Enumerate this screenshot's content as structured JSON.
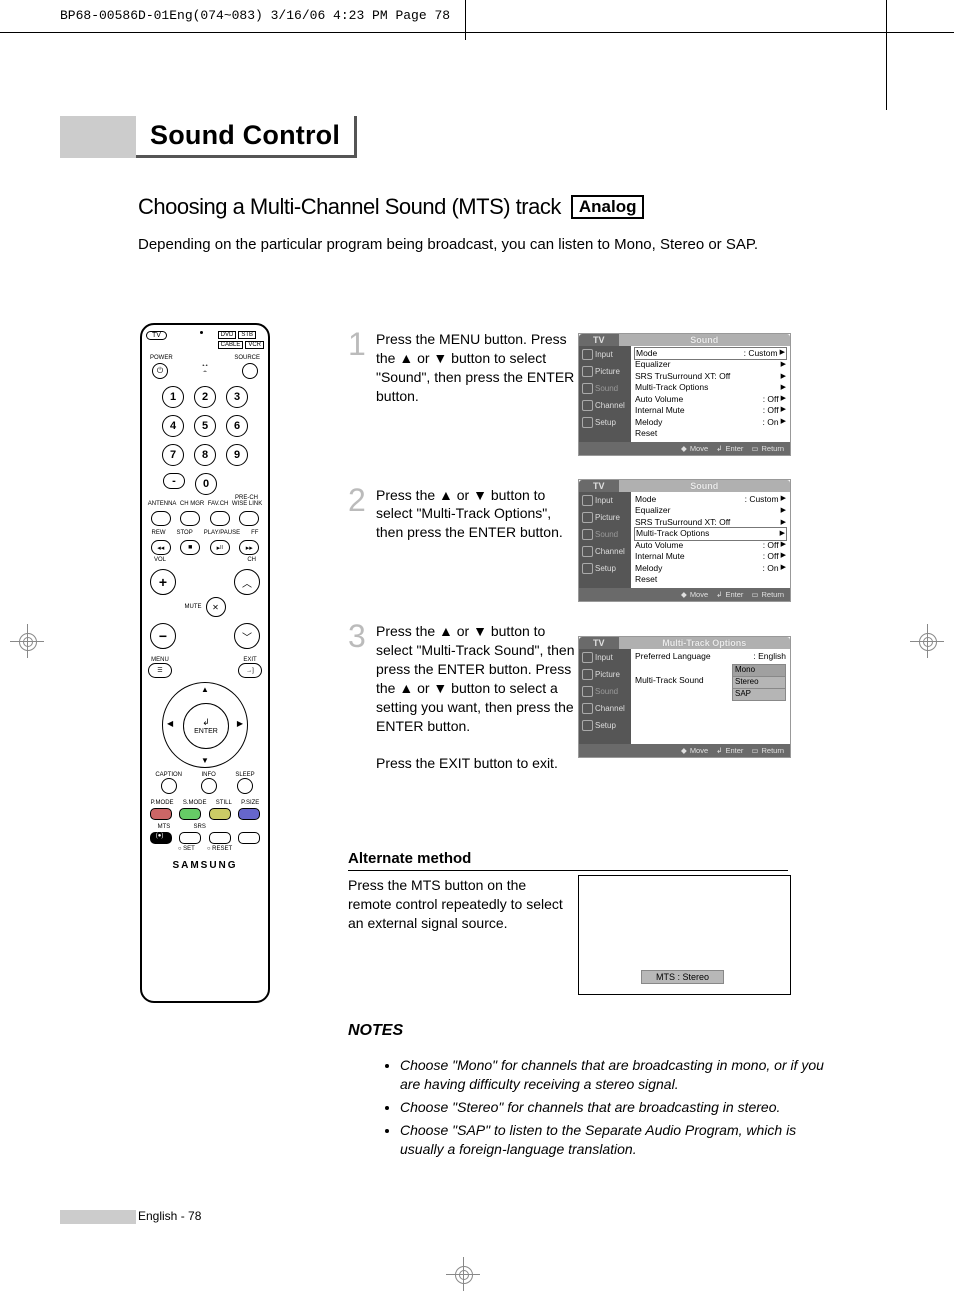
{
  "header_crop": "BP68-00586D-01Eng(074~083)  3/16/06  4:23 PM  Page 78",
  "section_title": "Sound Control",
  "subtitle_main": "Choosing a Multi-Channel Sound (MTS) track",
  "subtitle_box": "Analog",
  "intro": "Depending on the particular program being broadcast, you can listen to Mono, Stereo or SAP.",
  "remote": {
    "brand": "SAMSUNG",
    "tv": "TV",
    "top_buttons": [
      "DVD",
      "STB",
      "CABLE",
      "VCR"
    ],
    "power": "POWER",
    "source": "SOURCE",
    "numbers": [
      "1",
      "2",
      "3",
      "4",
      "5",
      "6",
      "7",
      "8",
      "9",
      "0"
    ],
    "dash": "-",
    "prech": "PRE-CH",
    "row_labels": [
      "ANTENNA",
      "CH MGR",
      "FAV.CH",
      "WISE LINK"
    ],
    "transport": [
      "REW",
      "STOP",
      "PLAY/PAUSE",
      "FF"
    ],
    "vol": "VOL",
    "ch": "CH",
    "mute": "MUTE",
    "menu": "MENU",
    "exit": "EXIT",
    "enter": "ENTER",
    "caption": "CAPTION",
    "info": "INFO",
    "sleep": "SLEEP",
    "pmode": "P.MODE",
    "smode": "S.MODE",
    "still": "STILL",
    "psize": "P.SIZE",
    "mts": "MTS",
    "srs": "SRS",
    "set": "SET",
    "reset": "RESET"
  },
  "steps": [
    {
      "num": "1",
      "text": "Press the MENU button.\nPress the ▲ or ▼ button to select \"Sound\", then press the ENTER button."
    },
    {
      "num": "2",
      "text": "Press the ▲ or ▼ button to select \"Multi-Track Options\", then press the ENTER button."
    },
    {
      "num": "3",
      "text": "Press the ▲ or ▼ button to select \"Multi-Track Sound\", then press the ENTER button. Press the ▲ or ▼ button to select a setting you want, then press the ENTER button.",
      "exit": "Press the EXIT button to exit."
    }
  ],
  "alt_heading": "Alternate method",
  "alt_text": "Press the MTS button on the remote control repeatedly to select an external signal source.",
  "osd": {
    "tv_tab": "TV",
    "sound_title": "Sound",
    "mt_title": "Multi-Track Options",
    "side": [
      "Input",
      "Picture",
      "Sound",
      "Channel",
      "Setup"
    ],
    "menu1": [
      {
        "l": "Mode",
        "v": ": Custom"
      },
      {
        "l": "Equalizer",
        "v": ""
      },
      {
        "l": "SRS TruSurround XT",
        "v": ": Off"
      },
      {
        "l": "Multi-Track Options",
        "v": ""
      },
      {
        "l": "Auto Volume",
        "v": ": Off"
      },
      {
        "l": "Internal Mute",
        "v": ": Off"
      },
      {
        "l": "Melody",
        "v": ": On"
      },
      {
        "l": "Reset",
        "v": ""
      }
    ],
    "menu3": [
      {
        "l": "Preferred Language",
        "v": ": English"
      },
      {
        "l": "Multi-Track Sound",
        "v": "",
        "opts": [
          "Mono",
          "Stereo",
          "SAP"
        ]
      }
    ],
    "footer": {
      "move": "Move",
      "enter": "Enter",
      "return": "Return"
    }
  },
  "mts_label": "MTS : Stereo",
  "notes_heading": "NOTES",
  "notes": [
    "Choose \"Mono\" for channels that are broadcasting in mono, or if you are having difficulty receiving a stereo signal.",
    "Choose \"Stereo\" for channels that are broadcasting in stereo.",
    "Choose \"SAP\" to listen to the Separate Audio Program, which is usually a foreign-language translation."
  ],
  "footer": "English - 78"
}
